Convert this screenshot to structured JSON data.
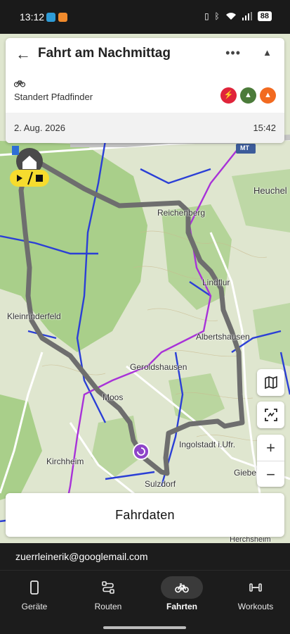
{
  "status_bar": {
    "time": "13:12",
    "battery": "88"
  },
  "trip": {
    "title": "Fahrt am Nachmittag",
    "device": "Standert Pfadfinder",
    "date": "2. Aug. 2026",
    "time": "15:42"
  },
  "map": {
    "labels": [
      {
        "name": "map-label-heuchel",
        "text": "Heuchel"
      },
      {
        "name": "map-label-reichenberg",
        "text": "Reichenberg"
      },
      {
        "name": "map-label-lindflur",
        "text": "Lindflur"
      },
      {
        "name": "map-label-kleinrinderfeld",
        "text": "Kleinrinderfeld"
      },
      {
        "name": "map-label-albertshausen",
        "text": "Albertshausen"
      },
      {
        "name": "map-label-geroldshausen",
        "text": "Geroldshausen"
      },
      {
        "name": "map-label-moos",
        "text": "Moos"
      },
      {
        "name": "map-label-kirchheim",
        "text": "Kirchheim"
      },
      {
        "name": "map-label-ingolstadt",
        "text": "Ingolstadt i.Ufr."
      },
      {
        "name": "map-label-giebelstadt",
        "text": "Giebe"
      },
      {
        "name": "map-label-sulzdorf",
        "text": "Sulzdorf"
      },
      {
        "name": "map-label-herchsheim",
        "text": "Herchsheim"
      }
    ],
    "highway_badge": "MT"
  },
  "fahrdaten_button": "Fahrdaten",
  "account_email": "zuerrleinerik@googlemail.com",
  "nav": {
    "items": [
      {
        "label": "Geräte",
        "icon": "phone-icon"
      },
      {
        "label": "Routen",
        "icon": "route-icon"
      },
      {
        "label": "Fahrten",
        "icon": "bicycle-icon",
        "active": true
      },
      {
        "label": "Workouts",
        "icon": "dumbbell-icon"
      }
    ]
  },
  "colors": {
    "route": "#6e6e6e",
    "cycle_path_blue": "#2b3fd6",
    "cycle_path_purple": "#a832d8",
    "start_badge": "#f6dc2e",
    "accent_purple": "#8e44c9"
  }
}
